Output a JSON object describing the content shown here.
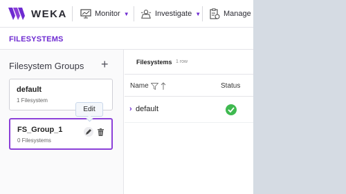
{
  "nav": {
    "brand": "WEKA",
    "items": [
      {
        "label": "Monitor",
        "icon": "monitor-icon"
      },
      {
        "label": "Investigate",
        "icon": "investigate-icon"
      },
      {
        "label": "Manage",
        "icon": "manage-icon"
      }
    ]
  },
  "page": {
    "title": "FILESYSTEMS"
  },
  "groups": {
    "title": "Filesystem Groups",
    "add_label": "+",
    "items": [
      {
        "name": "default",
        "count": "1 Filesystem"
      },
      {
        "name": "FS_Group_1",
        "count": "0 Filesystems"
      }
    ],
    "tooltip": "Edit"
  },
  "table": {
    "title": "Filesystems",
    "row_count": "1 row",
    "columns": {
      "name": "Name",
      "status": "Status"
    },
    "rows": [
      {
        "name": "default",
        "status": "ok"
      }
    ]
  },
  "colors": {
    "accent": "#6e2bd1",
    "status_ok": "#3fb950",
    "selected_border": "#8b3fd8"
  }
}
